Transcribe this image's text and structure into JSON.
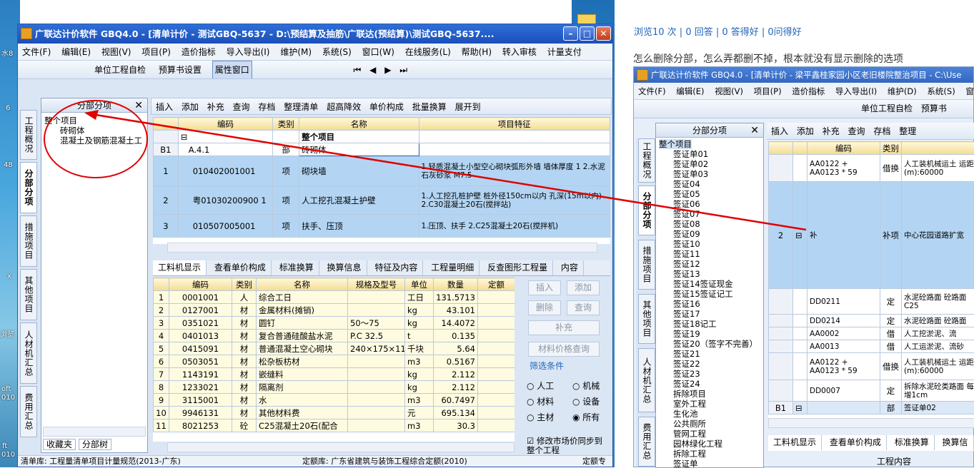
{
  "desktop": {
    "labels": [
      "水8",
      "6",
      "48",
      "浏览",
      "oft",
      "010",
      "ft",
      "010",
      "x"
    ]
  },
  "main_window": {
    "title": "广联达计价软件 GBQ4.0 - [清单计价 - 测试GBQ-5637 - D:\\预结算及抽筋\\广联达(预结算)\\测试GBQ-5637....",
    "menu": [
      "文件(F)",
      "编辑(E)",
      "视图(V)",
      "项目(P)",
      "造价指标",
      "导入导出(I)",
      "维护(M)",
      "系统(S)",
      "窗口(W)",
      "在线服务(L)",
      "帮助(H)",
      "转入审核",
      "计量支付"
    ],
    "toolbar1": [
      "单位工程自检",
      "预算书设置",
      "属性窗口"
    ],
    "toolbar2": [
      "插入",
      "添加",
      "补充",
      "查询",
      "存档",
      "整理清单",
      "超高降效",
      "单价构成",
      "批量换算",
      "展开到"
    ],
    "side_tabs": [
      "工程概况",
      "分部分项",
      "措施项目",
      "其他项目",
      "人材机汇总",
      "费用汇总"
    ],
    "tree": {
      "header": "分部分项",
      "items": [
        "整个项目",
        "砖砌体",
        "混凝土及钢筋混凝土工"
      ],
      "bottom_tabs": [
        "收藏夹",
        "分部树"
      ]
    },
    "upper_table": {
      "headers": [
        "编码",
        "类别",
        "名称",
        "项目特征"
      ],
      "rows": [
        {
          "num": "",
          "code": "",
          "type": "",
          "name": "整个项目",
          "feature": ""
        },
        {
          "num": "B1",
          "code": "A.4.1",
          "type": "部",
          "name": "砖砌体",
          "feature": ""
        },
        {
          "num": "1",
          "code": "010402001001",
          "type": "项",
          "name": "砌块墙",
          "feature": "1.轻质混凝土小型空心砌块弧形外墙 墙体厚度 1 2.水泥石灰砂浆 M7.5"
        },
        {
          "num": "2",
          "code": "粤01030200900 1",
          "type": "项",
          "name": "人工挖孔混凝土护壁",
          "feature": "1.人工挖孔桩护壁 桩外径150cm以内 孔深(15m以内) 2.C30混凝土20石(搅拌站)"
        },
        {
          "num": "3",
          "code": "010507005001",
          "type": "项",
          "name": "扶手、压顶",
          "feature": "1.压顶、扶手 2.C25混凝土20石(搅拌机)"
        }
      ]
    },
    "lower_tabs": [
      "工料机显示",
      "查看单价构成",
      "标准换算",
      "换算信息",
      "特征及内容",
      "工程量明细",
      "反查图形工程量",
      "内容"
    ],
    "lower_table": {
      "headers": [
        "编码",
        "类别",
        "名称",
        "规格及型号",
        "单位",
        "数量",
        "定额"
      ],
      "rows": [
        [
          "1",
          "0001001",
          "人",
          "综合工日",
          "",
          "工日",
          "131.5713"
        ],
        [
          "2",
          "0127001",
          "材",
          "金属材料(摊销)",
          "",
          "kg",
          "43.101"
        ],
        [
          "3",
          "0351021",
          "材",
          "圆钉",
          "50～75",
          "kg",
          "14.4072"
        ],
        [
          "4",
          "0401013",
          "材",
          "复合普通硅酸盐水泥",
          "P.C 32.5",
          "t",
          "0.135"
        ],
        [
          "5",
          "0415091",
          "材",
          "普通混凝土空心砌块",
          "240×175×11",
          "千块",
          "5.64"
        ],
        [
          "6",
          "0503051",
          "材",
          "松杂板枋材",
          "",
          "m3",
          "0.5167"
        ],
        [
          "7",
          "1143191",
          "材",
          "嵌缝料",
          "",
          "kg",
          "2.112"
        ],
        [
          "8",
          "1233021",
          "材",
          "隔离剂",
          "",
          "kg",
          "2.112"
        ],
        [
          "9",
          "3115001",
          "材",
          "水",
          "",
          "m3",
          "60.7497"
        ],
        [
          "10",
          "9946131",
          "材",
          "其他材料费",
          "",
          "元",
          "695.134"
        ],
        [
          "11",
          "8021253",
          "砼",
          "C25混凝土20石(配合",
          "",
          "m3",
          "30.3"
        ]
      ]
    },
    "right_buttons": [
      "插入",
      "添加",
      "删除",
      "查询",
      "补充",
      "材料价格查询"
    ],
    "filter": {
      "label": "筛选条件",
      "options": [
        "人工",
        "机械",
        "材料",
        "设备",
        "主材",
        "所有"
      ],
      "selected": "所有",
      "sync_label": "修改市场价同步到整个工程"
    },
    "status": {
      "left": "清单库: 工程量清单项目计量规范(2013-广东)",
      "mid": "定额库: 广东省建筑与装饰工程综合定额(2010)",
      "right": "定额专"
    }
  },
  "question": {
    "stats": "浏览10 次 | 0 回答 | 0 答得好 | 0问得好",
    "text": "怎么删除分部，怎么弄都删不掉，根本就没有显示删除的选项"
  },
  "second_window": {
    "title": "广联达计价软件 GBQ4.0 - [清单计价 - 梁平鑫桂家园小区老旧楼院整治项目 - C:\\Use",
    "menu": [
      "文件(F)",
      "编辑(E)",
      "视图(V)",
      "项目(P)",
      "造价指标",
      "导入导出(I)",
      "维护(D)",
      "系统(S)",
      "窗口"
    ],
    "toolbar1": [
      "单位工程自检",
      "预算书"
    ],
    "toolbar2": [
      "插入",
      "添加",
      "补充",
      "查询",
      "存档",
      "整理"
    ],
    "side_tabs": [
      "工程概况",
      "分部分项",
      "措施项目",
      "其他项目",
      "人材机汇总",
      "费用汇总"
    ],
    "tree_header": "分部分项",
    "tree_items": [
      "整个项目",
      "签证单01",
      "签证单02",
      "签证单03",
      "签证04",
      "签证05",
      "签证06",
      "签证07",
      "签证08",
      "签证09",
      "签证10",
      "签证11",
      "签证12",
      "签证13",
      "签证14签证现金",
      "签证15签证记工",
      "签证16",
      "签证17",
      "签证18记工",
      "签证19",
      "签证20（签字不完善）",
      "签证21",
      "签证22",
      "签证23",
      "签证24",
      "拆除项目",
      "室外工程",
      "生化池",
      "公共厕所",
      "管网工程",
      "园林绿化工程",
      "拆除工程",
      "签证单"
    ],
    "table_headers": [
      "编码",
      "类别"
    ],
    "rows": [
      {
        "num": "",
        "code": "AA0122 + AA0123 * 59",
        "type": "借换",
        "name": "人工装机械运土 运距(m):60000"
      },
      {
        "num": "2",
        "code": "补",
        "type": "补项",
        "name": "中心花园道路扩宽"
      },
      {
        "num": "",
        "code": "DD0211",
        "type": "定",
        "name": "水泥砼路面 砼路面 C25"
      },
      {
        "num": "",
        "code": "DD0214",
        "type": "定",
        "name": "水泥砼路面 砼路面"
      },
      {
        "num": "",
        "code": "AA0002",
        "type": "借",
        "name": "人工挖淤泥、流"
      },
      {
        "num": "",
        "code": "AA0013",
        "type": "借",
        "name": "人工运淤泥、流砂"
      },
      {
        "num": "",
        "code": "AA0122 + AA0123 * 59",
        "type": "借换",
        "name": "人工装机械运土 运距(m):60000"
      },
      {
        "num": "",
        "code": "DD0007",
        "type": "定",
        "name": "拆除水泥砼类路面 每增1cm"
      },
      {
        "num": "B1",
        "code": "",
        "type": "部",
        "name": "签证单02"
      }
    ],
    "lower_tabs": [
      "工料机显示",
      "查看单价构成",
      "标准换算",
      "换算信"
    ],
    "footer": "工程内容"
  },
  "colors": {
    "annotation": "#e00000",
    "title_blue": "#1a4fba",
    "selected_row": "#b3d5f3"
  }
}
